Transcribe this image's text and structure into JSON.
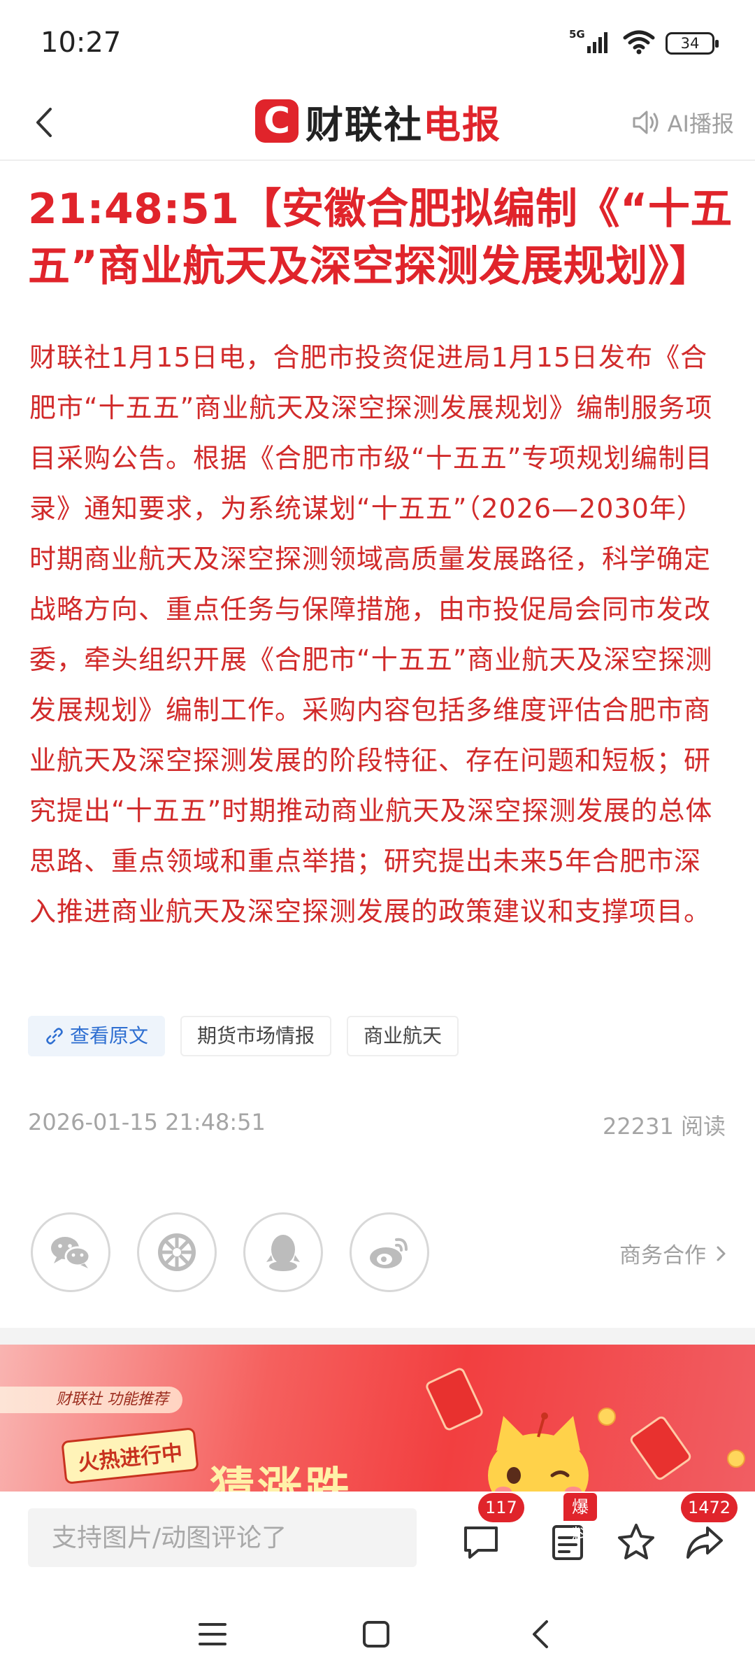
{
  "status_bar": {
    "time": "10:27",
    "network": "5G",
    "battery": "34"
  },
  "header": {
    "logo_mark": "C",
    "logo_part1": "财联社",
    "logo_part2": "电报",
    "ai_broadcast_label": "AI播报"
  },
  "article": {
    "title": "21:48:51【安徽合肥拟编制《“十五五”商业航天及深空探测发展规划》】",
    "body": "财联社1月15日电，合肥市投资促进局1月15日发布《合肥市“十五五”商业航天及深空探测发展规划》编制服务项目采购公告。根据《合肥市市级“十五五”专项规划编制目录》通知要求，为系统谋划“十五五”（2026—2030年）时期商业航天及深空探测领域高质量发展路径，科学确定战略方向、重点任务与保障措施，由市投促局会同市发改委，牵头组织开展《合肥市“十五五”商业航天及深空探测发展规划》编制工作。采购内容包括多维度评估合肥市商业航天及深空探测发展的阶段特征、存在问题和短板；研究提出“十五五”时期推动商业航天及深空探测发展的总体思路、重点领域和重点举措；研究提出未来5年合肥市深入推进商业航天及深空探测发展的政策建议和支撑项目。"
  },
  "tags": {
    "view_original": "查看原文",
    "tag1": "期货市场情报",
    "tag2": "商业航天"
  },
  "meta": {
    "datetime": "2026-01-15 21:48:51",
    "reads": "22231 阅读"
  },
  "share": {
    "business_label": "商务合作",
    "icons": [
      "wechat-icon",
      "moments-icon",
      "qq-icon",
      "weibo-icon"
    ]
  },
  "banner": {
    "pill_text": "财联社 功能推荐",
    "hot_text": "火热进行中",
    "big_text": "猜涨跌"
  },
  "bottom_bar": {
    "comment_placeholder": "支持图片/动图评论了",
    "comments_count": "117",
    "report_badge": "爆料",
    "share_count": "1472"
  },
  "colors": {
    "brand_red": "#e0242b",
    "body_red": "#d12a2a",
    "link_blue": "#2f6fd1"
  }
}
